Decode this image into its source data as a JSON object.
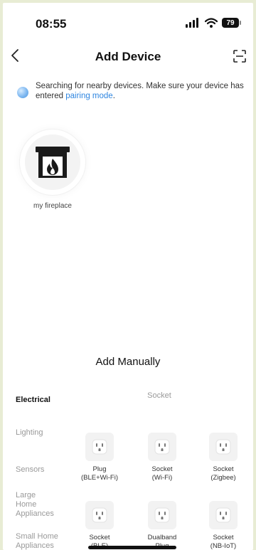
{
  "status_bar": {
    "time": "08:55",
    "battery": "79"
  },
  "nav": {
    "title": "Add Device"
  },
  "banner": {
    "text": "Searching for nearby devices. Make sure your device has entered",
    "link": "pairing mode",
    "suffix": "."
  },
  "found_devices": [
    {
      "name": "my fireplace",
      "icon": "fireplace-icon"
    }
  ],
  "add_manually": {
    "title": "Add Manually",
    "categories": [
      {
        "label": "Electrical",
        "active": true
      },
      {
        "label": "Lighting",
        "active": false
      },
      {
        "label": "Sensors",
        "active": false
      },
      {
        "label": "Large Home Appliances",
        "active": false
      },
      {
        "label": "Small Home Appliances",
        "active": false
      }
    ],
    "section_label": "Socket",
    "products": [
      {
        "line1": "Plug",
        "line2": "(BLE+Wi-Fi)"
      },
      {
        "line1": "Socket",
        "line2": "(Wi-Fi)"
      },
      {
        "line1": "Socket",
        "line2": "(Zigbee)"
      },
      {
        "line1": "Socket",
        "line2": "(BLE)"
      },
      {
        "line1": "Dualband",
        "line2": "Plug"
      },
      {
        "line1": "Socket",
        "line2": "(NB-IoT)"
      }
    ]
  },
  "colors": {
    "link": "#2f86e0",
    "background": "#ffffff",
    "frame": "#e8ecd4"
  }
}
